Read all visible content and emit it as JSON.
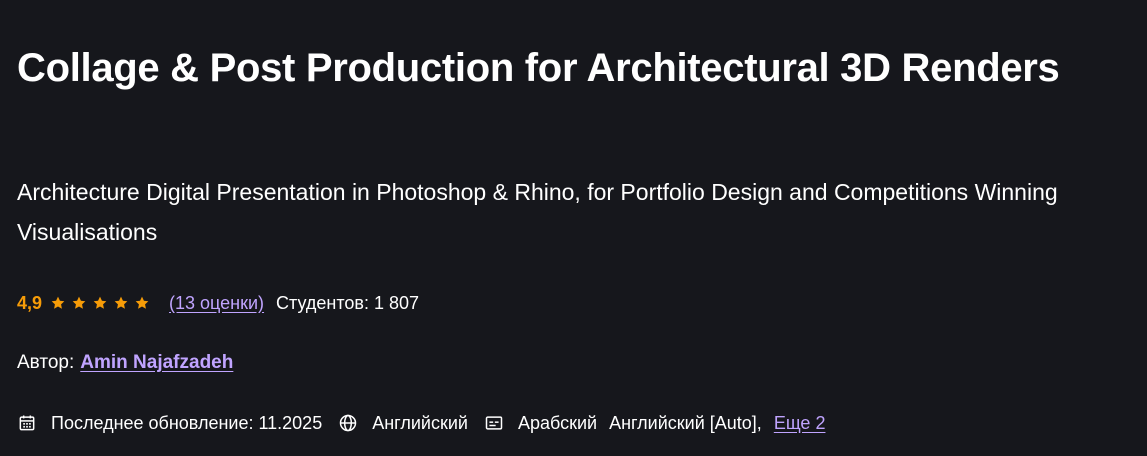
{
  "course": {
    "title": "Collage & Post Production for Architectural 3D Renders",
    "subtitle": "Architecture Digital Presentation in Photoshop & Rhino, for Portfolio Design and Competitions Winning Visualisations"
  },
  "rating": {
    "value": "4,9",
    "stars": 5,
    "count_link": "(13 оценки)",
    "students": "Студентов: 1 807"
  },
  "author": {
    "label": "Автор:",
    "name": "Amin Najafzadeh"
  },
  "meta": {
    "updated": "Последнее обновление: 11.2025",
    "language": "Английский",
    "captions_1": "Арабский",
    "captions_2": "Английский [Auto],",
    "more_link": "Еще 2"
  },
  "colors": {
    "background": "#16171c",
    "rating": "#f69c08",
    "link": "#c0a4ff",
    "text": "#ffffff"
  },
  "icons": {
    "updated": "calendar-icon",
    "language": "globe-icon",
    "captions": "closed-captions-icon",
    "rating": "star-icon"
  }
}
